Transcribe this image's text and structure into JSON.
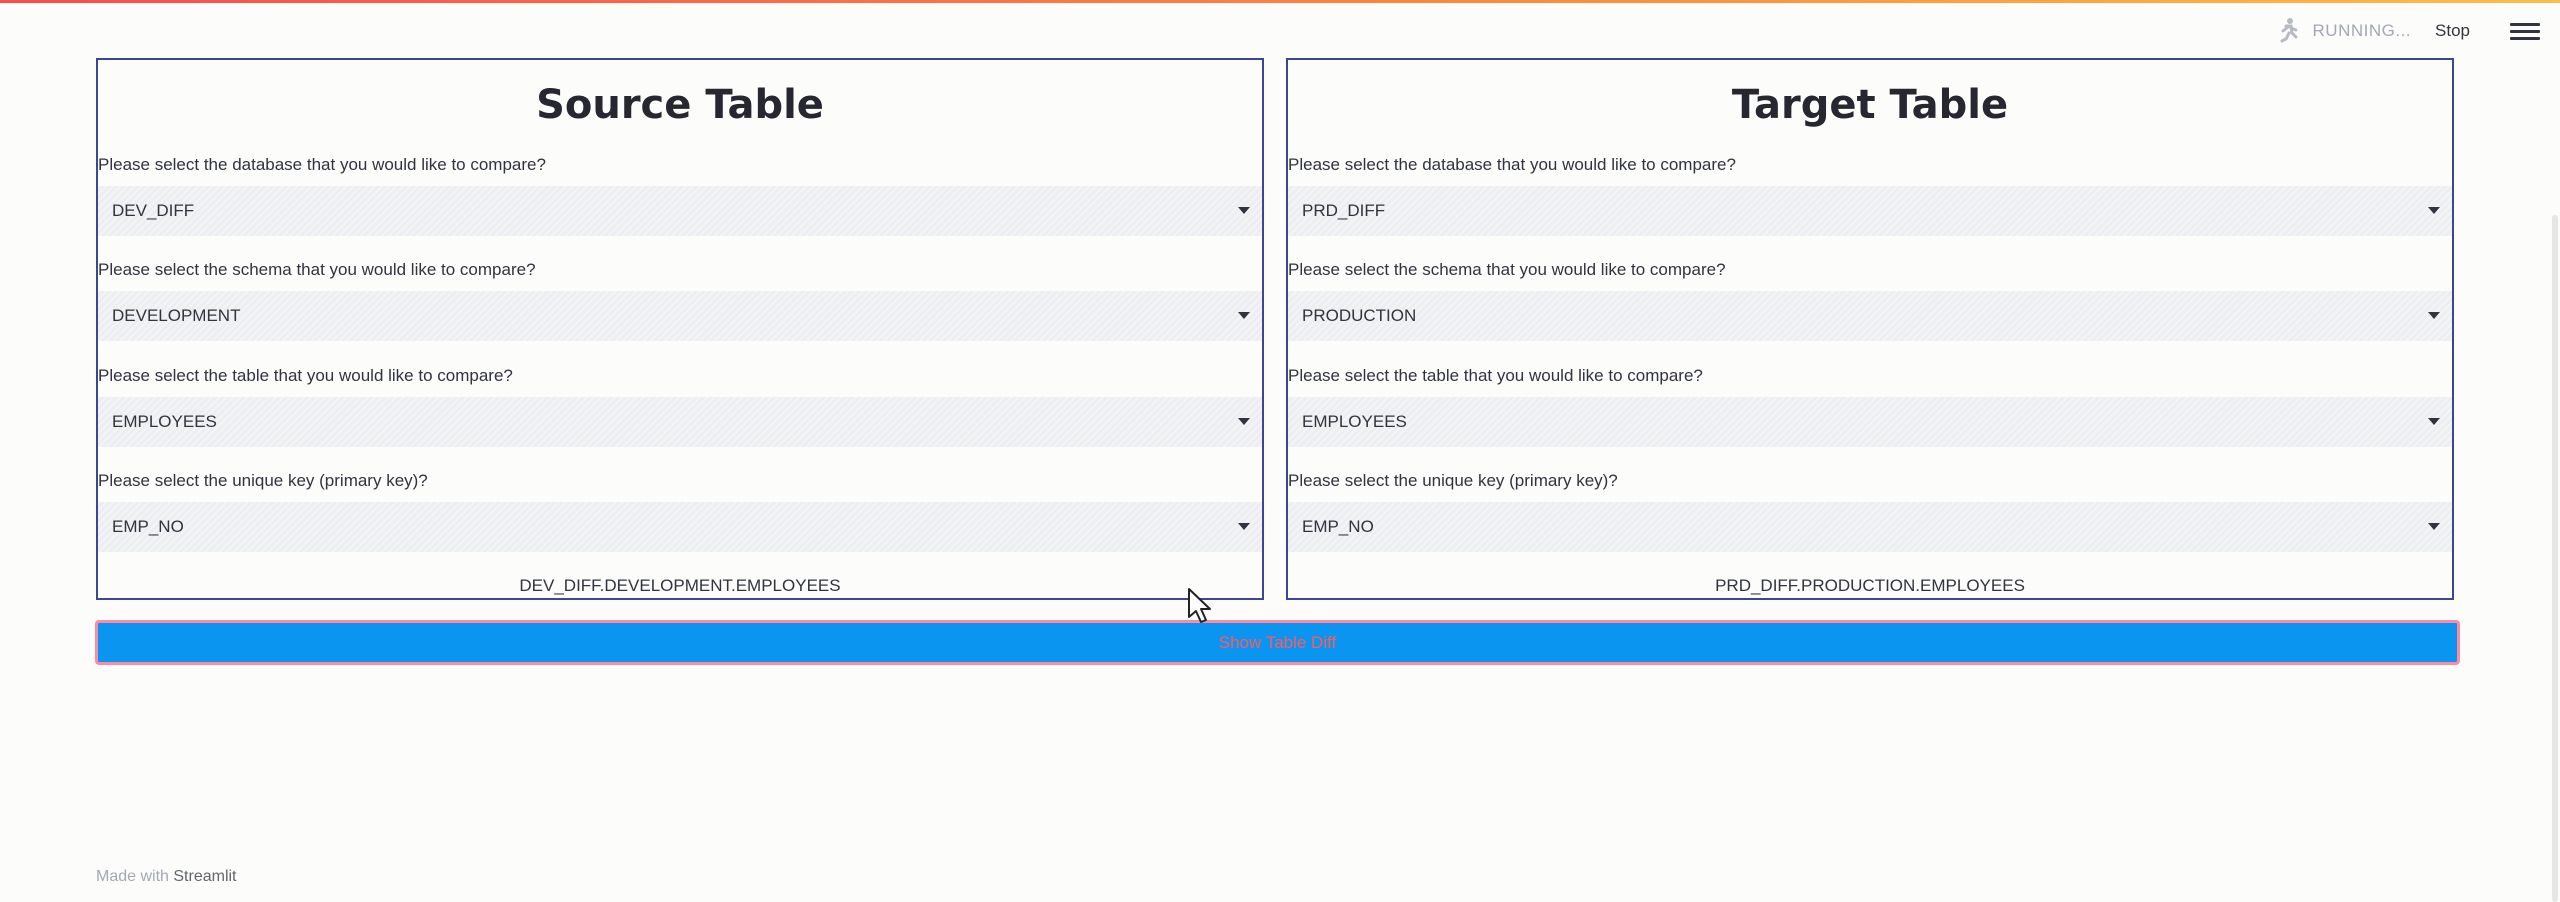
{
  "status": {
    "running_label": "RUNNING...",
    "stop_label": "Stop",
    "running_icon": "running-man-icon",
    "menu_icon": "hamburger-menu-icon"
  },
  "source": {
    "title": "Source Table",
    "fields": [
      {
        "label": "Please select the database that you would like to compare?",
        "value": "DEV_DIFF"
      },
      {
        "label": "Please select the schema that you would like to compare?",
        "value": "DEVELOPMENT"
      },
      {
        "label": "Please select the table that you would like to compare?",
        "value": "EMPLOYEES"
      },
      {
        "label": "Please select the unique key (primary key)?",
        "value": "EMP_NO"
      }
    ],
    "path": "DEV_DIFF.DEVELOPMENT.EMPLOYEES"
  },
  "target": {
    "title": "Target Table",
    "fields": [
      {
        "label": "Please select the database that you would like to compare?",
        "value": "PRD_DIFF"
      },
      {
        "label": "Please select the schema that you would like to compare?",
        "value": "PRODUCTION"
      },
      {
        "label": "Please select the table that you would like to compare?",
        "value": "EMPLOYEES"
      },
      {
        "label": "Please select the unique key (primary key)?",
        "value": "EMP_NO"
      }
    ],
    "path": "PRD_DIFF.PRODUCTION.EMPLOYEES"
  },
  "action": {
    "label": "Show Table Diff"
  },
  "footer": {
    "prefix": "Made with ",
    "link": "Streamlit"
  },
  "colors": {
    "panel_border": "#3e4597",
    "button_bg": "#0a96f0",
    "button_border": "#ff8ba0",
    "button_text": "#ff5b5b",
    "accent": "#ff4b4b"
  }
}
